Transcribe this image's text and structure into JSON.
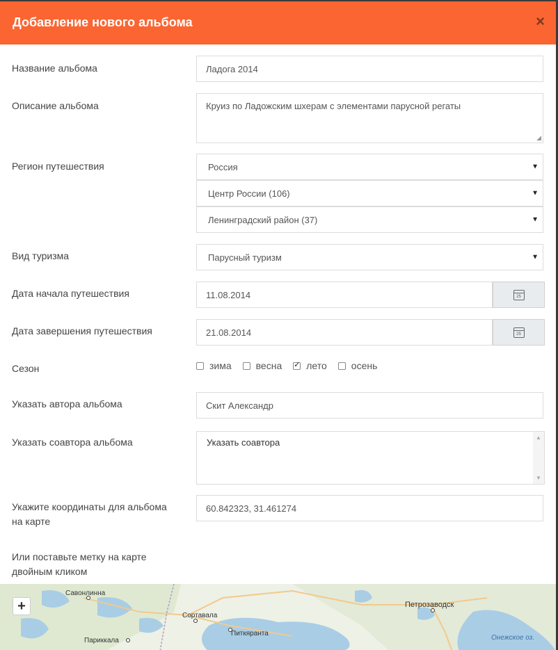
{
  "modal": {
    "title": "Добавление нового альбома",
    "close": "×"
  },
  "form": {
    "album_name": {
      "label": "Название альбома",
      "value": "Ладога 2014"
    },
    "album_desc": {
      "label": "Описание альбома",
      "value": "Круиз по Ладожским шхерам с элементами парусной регаты"
    },
    "region": {
      "label": "Регион путешествия",
      "country": "Россия",
      "area": "Центр России (106)",
      "district": "Ленинградский район (37)"
    },
    "tourism": {
      "label": "Вид туризма",
      "value": "Парусный туризм"
    },
    "date_start": {
      "label": "Дата начала путешествия",
      "value": "11.08.2014",
      "cal": "25"
    },
    "date_end": {
      "label": "Дата завершения путешествия",
      "value": "21.08.2014",
      "cal": "25"
    },
    "season": {
      "label": "Сезон",
      "options": [
        {
          "label": "зима",
          "checked": false
        },
        {
          "label": "весна",
          "checked": false
        },
        {
          "label": "лето",
          "checked": true
        },
        {
          "label": "осень",
          "checked": false
        }
      ]
    },
    "author": {
      "label": "Указать автора альбома",
      "value": "Скит Александр"
    },
    "coauthor": {
      "label": "Указать соавтора альбома",
      "value": "Указать соавтора"
    },
    "coords": {
      "label_line1": "Укажите координаты для альбома",
      "label_line2": "на карте",
      "value": "60.842323, 31.461274"
    },
    "map_hint": {
      "line1": "Или поставьте метку на карте",
      "line2": "двойным кликом"
    }
  },
  "map": {
    "zoom_in": "+",
    "places": [
      "Савонлинна",
      "Сортавала",
      "Питкяранта",
      "Петрозаводск",
      "Париккала",
      "Онежское оз."
    ]
  }
}
